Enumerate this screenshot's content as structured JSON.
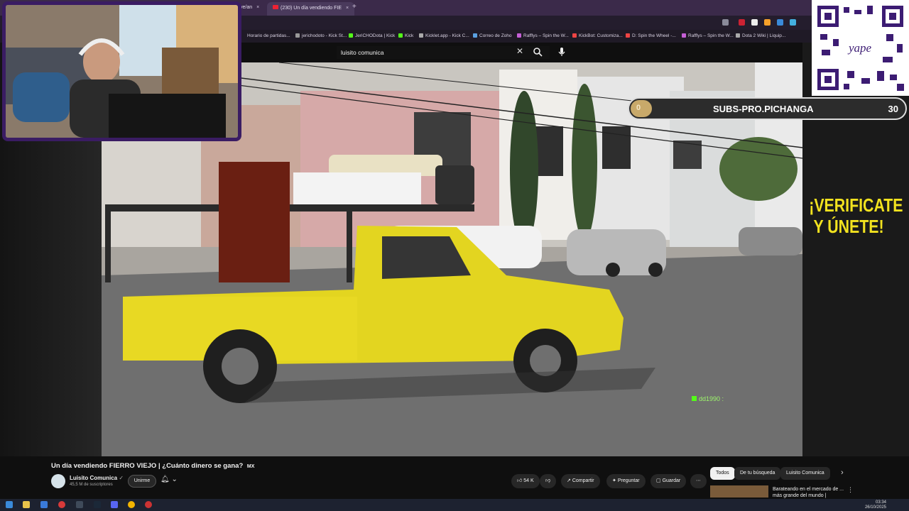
{
  "browser": {
    "tabs": [
      {
        "label": "ye/an",
        "active": false
      },
      {
        "label": "(230) Un día vendiendo FIE",
        "active": true
      }
    ],
    "bookmarks": [
      "Horario de partidas...",
      "jerichodoto - Kick St...",
      "JeriCHODota | Kick",
      "Kick",
      "Kicklet.app - Kick C...",
      "Correo de Zoho",
      "Rafflys – Spin the W...",
      "KickBot: Customiza...",
      "D: Spin the Wheel -...",
      "Rafflys – Spin the W...",
      "Dota 2 Wiki | Liquip..."
    ]
  },
  "search": {
    "value": "luisito comunica"
  },
  "overlay": {
    "goal_current": "0",
    "goal_title": "SUBS-PRO.PICHANGA",
    "goal_target": "30",
    "verify_text": "¡VERIFICATE Y ÚNETE!",
    "chat_user": "dd1990 :",
    "qr_brand": "yape"
  },
  "video": {
    "title": "Un día vendiendo FIERRO VIEJO | ¿Cuánto dinero se gana?",
    "title_flag": "MX",
    "channel": "Luisito Comunica",
    "subscribers": "45,5 M de suscriptores",
    "join_label": "Unirme",
    "likes": "54 K",
    "share_label": "Compartir",
    "ask_label": "Preguntar",
    "save_label": "Guardar"
  },
  "chips": [
    "Todos",
    "De tu búsqueda",
    "Luisito Comunica"
  ],
  "recommendation": {
    "title": "Barateando en el mercado de ... más grande del mundo |"
  },
  "taskbar": {
    "time": "03:34",
    "date": "26/10/2025"
  },
  "colors": {
    "accent_purple": "#6b3fa8",
    "verify_yellow": "#f2e21f",
    "goal_fill": "#c8a96a"
  }
}
